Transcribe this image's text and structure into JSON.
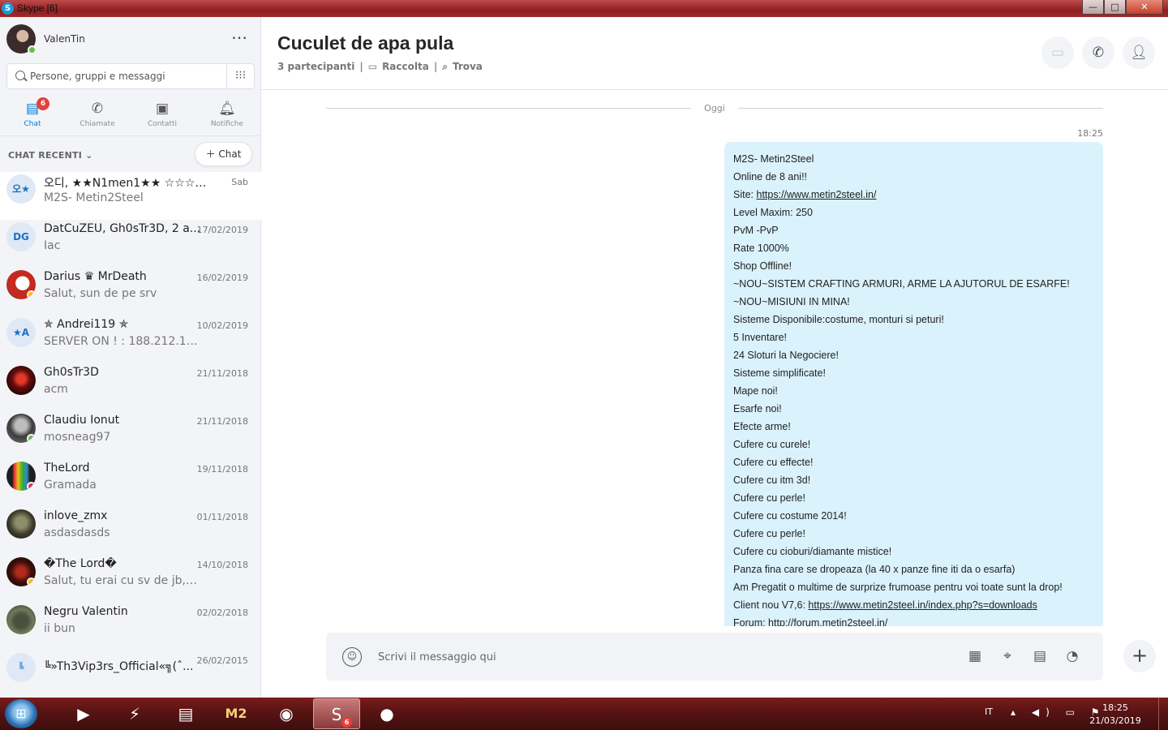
{
  "window": {
    "title": "Skype [6]",
    "controls": {
      "minimize": "—",
      "maximize": "□",
      "close": "✕"
    }
  },
  "sidebar": {
    "profile": {
      "name": "ValenTin",
      "status": "online",
      "more_label": "⋯"
    },
    "search": {
      "placeholder": "Persone, gruppi e messaggi",
      "value": ""
    },
    "tabs": [
      {
        "label": "Chat",
        "icon": "chat-icon",
        "badge": "6",
        "active": true
      },
      {
        "label": "Chiamate",
        "icon": "phone-icon"
      },
      {
        "label": "Contatti",
        "icon": "contacts-icon"
      },
      {
        "label": "Notifiche",
        "icon": "bell-icon"
      }
    ],
    "recent_header": "CHAT RECENTI",
    "new_chat_label": "Chat",
    "chats": [
      {
        "initials": "오★",
        "name": "오디, ★★N1men1★★ ☆☆☆☆...",
        "date": "Sab",
        "preview": "M2S- Metin2Steel",
        "highlight": true
      },
      {
        "initials": "DG",
        "name": "DatCuZEU, Gh0sTr3D, 2 a...",
        "date": "17/02/2019",
        "preview": "Iac"
      },
      {
        "initials": "",
        "name": "Darius ♛ MrDeath",
        "date": "16/02/2019",
        "preview": "Salut, sun de pe srv",
        "presence": "away"
      },
      {
        "initials": "★A",
        "name": "✯ Andrei119 ✯",
        "date": "10/02/2019",
        "preview": "SERVER ON ! : 188.212.100...."
      },
      {
        "initials": "",
        "name": "Gh0sTr3D",
        "date": "21/11/2018",
        "preview": "acm"
      },
      {
        "initials": "",
        "name": "Claudiu Ionut",
        "date": "21/11/2018",
        "preview": "mosneag97",
        "presence": "online"
      },
      {
        "initials": "",
        "name": "TheLord",
        "date": "19/11/2018",
        "preview": "Gramada",
        "presence": "dnd"
      },
      {
        "initials": "",
        "name": "inlove_zmx",
        "date": "01/11/2018",
        "preview": "asdasdasds"
      },
      {
        "initials": "",
        "name": "�The Lord�",
        "date": "14/10/2018",
        "preview": "Salut, tu erai cu sv de jb, pa...",
        "presence": "away"
      },
      {
        "initials": "",
        "name": "Negru Valentin",
        "date": "02/02/2018",
        "preview": "ii bun"
      },
      {
        "initials": "╚",
        "name": "╚»Th3Vip3rs_Official«╗(ˆ...",
        "date": "26/02/2015",
        "preview": ""
      }
    ]
  },
  "conversation": {
    "title": "Cuculet de apa pula",
    "participants": "3 partecipanti",
    "gallery": "Raccolta",
    "find": "Trova",
    "day_label": "Oggi",
    "message_time": "18:25",
    "message_lines": [
      {
        "text": "M2S- Metin2Steel"
      },
      {
        "text": "Online de 8 ani!!"
      },
      {
        "text": "Site: ",
        "link": "https://www.metin2steel.in/"
      },
      {
        "text": "Level Maxim: 250"
      },
      {
        "text": "PvM -PvP"
      },
      {
        "text": "Rate 1000%"
      },
      {
        "text": "Shop Offline!"
      },
      {
        "text": "~NOU~SISTEM CRAFTING ARMURI, ARME LA AJUTORUL DE ESARFE!"
      },
      {
        "text": "~NOU~MISIUNI IN MINA!"
      },
      {
        "text": "Sisteme Disponibile:costume, monturi si peturi!"
      },
      {
        "text": "5 Inventare!"
      },
      {
        "text": "24 Sloturi la Negociere!"
      },
      {
        "text": "Sisteme simplificate!"
      },
      {
        "text": "Mape noi!"
      },
      {
        "text": "Esarfe noi!"
      },
      {
        "text": "Efecte arme!"
      },
      {
        "text": "Cufere cu curele!"
      },
      {
        "text": "Cufere cu effecte!"
      },
      {
        "text": "Cufere cu itm 3d!"
      },
      {
        "text": "Cufere cu perle!"
      },
      {
        "text": "Cufere cu costume 2014!"
      },
      {
        "text": "Cufere cu perle!"
      },
      {
        "text": "Cufere cu cioburi/diamante mistice!"
      },
      {
        "text": "Panza fina care se dropeaza (la 40 x panze fine iti da o esarfa)"
      },
      {
        "text": "Am Pregatit o multime de surprize frumoase pentru voi toate sunt la drop!"
      },
      {
        "text": "Client nou V7,6: ",
        "link": "https://www.metin2steel.in/index.php?s=downloads"
      },
      {
        "text": "Forum: http://forum.metin2steel.in/"
      }
    ],
    "composer_placeholder": "Scrivi il messaggio qui"
  },
  "taskbar": {
    "lang": "IT",
    "time": "18:25",
    "date": "21/03/2019",
    "skype_badge": "6",
    "m2_label": "M2"
  }
}
